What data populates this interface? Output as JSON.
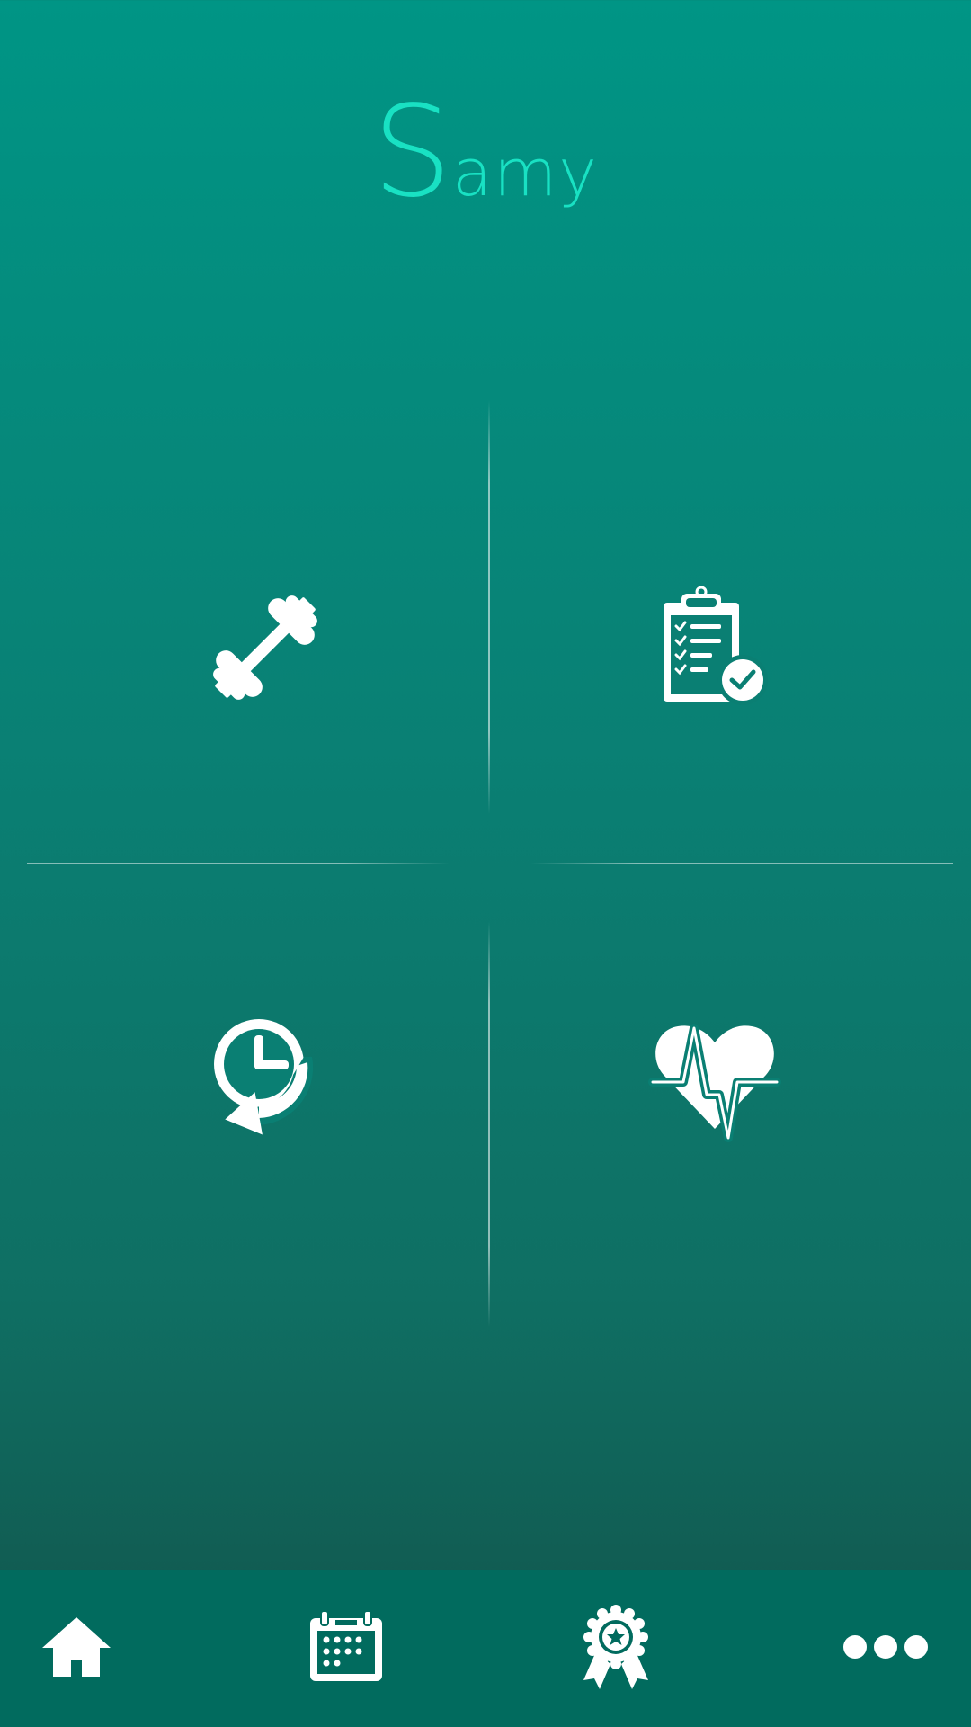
{
  "app": {
    "logo_initial": "S",
    "logo_rest": "amy",
    "accent_color": "#19e1c3",
    "background_top": "#009585",
    "background_bottom": "#134e47",
    "tabbar_color": "#016b5e"
  },
  "tiles": [
    {
      "name": "workout",
      "icon": "dumbbell-icon"
    },
    {
      "name": "plan",
      "icon": "clipboard-check-icon"
    },
    {
      "name": "history",
      "icon": "clock-history-icon"
    },
    {
      "name": "health",
      "icon": "heart-pulse-icon"
    }
  ],
  "tabbar": {
    "tabs": [
      {
        "name": "home",
        "icon": "home-icon",
        "active": true
      },
      {
        "name": "calendar",
        "icon": "calendar-icon",
        "active": false
      },
      {
        "name": "achievements",
        "icon": "award-badge-icon",
        "active": false
      },
      {
        "name": "more",
        "icon": "more-dots-icon",
        "active": false
      }
    ]
  }
}
